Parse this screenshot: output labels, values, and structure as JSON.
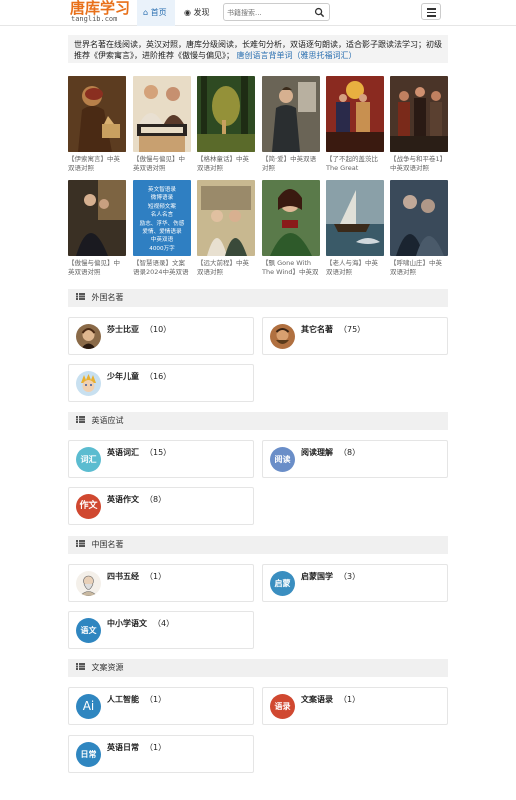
{
  "header": {
    "logo_cn": "唐库学习",
    "logo_en": "tanglib.com",
    "tabs": [
      {
        "label": "首页",
        "active": true
      },
      {
        "label": "发现",
        "active": false
      }
    ],
    "search_placeholder": "书籍搜索..."
  },
  "intro": {
    "text": "世界名著在线阅读，英汉对照，唐库分级阅读，长难句分析，双语逐句朗读，适合影子跟读法学习；初级推荐《伊索寓言》，进阶推荐《傲慢与偏见》；",
    "link": "唐创语言背单词（雅思托福词汇）"
  },
  "books": [
    {
      "caption": "【伊索寓言】中英双语对照"
    },
    {
      "caption": "【傲慢与偏见】中英双语对照"
    },
    {
      "caption": "【格林童话】中英双语对照"
    },
    {
      "caption": "【简·爱】中英双语对照"
    },
    {
      "caption": "【了不起的盖茨比 The Great Gatsby..."
    },
    {
      "caption": "【战争与和平卷1】中英双语对照"
    },
    {
      "caption": "【傲慢与偏见】中英双语对照"
    },
    {
      "caption": "【智慧语录】文案语录2024中英双语版"
    },
    {
      "caption": "【远大前程】中英双语对照"
    },
    {
      "caption": "【飘 Gone With The Wind】中英双语对..."
    },
    {
      "caption": "【老人与海】中英双语对照"
    },
    {
      "caption": "【呼啸山庄】中英双语对照"
    }
  ],
  "promo_cover": [
    "英文智语录",
    "微博语录",
    "短视频文案",
    "名人名言",
    "励志、浮华、伤感",
    "爱情、爱情语录",
    "中英双语",
    "4000万字"
  ],
  "sections": [
    {
      "title": "外国名著",
      "items": [
        {
          "name": "莎士比亚",
          "count": "（10）"
        },
        {
          "name": "其它名著",
          "count": "（75）"
        },
        {
          "name": "少年儿童",
          "count": "（16）"
        }
      ]
    },
    {
      "title": "英语应试",
      "items": [
        {
          "name": "英语词汇",
          "count": "（15）",
          "icon_text": "词汇"
        },
        {
          "name": "阅读理解",
          "count": "（8）",
          "icon_text": "阅读"
        },
        {
          "name": "英语作文",
          "count": "（8）",
          "icon_text": "作文"
        }
      ]
    },
    {
      "title": "中国名著",
      "items": [
        {
          "name": "四书五经",
          "count": "（1）"
        },
        {
          "name": "启蒙国学",
          "count": "（3）",
          "icon_text": "启蒙"
        },
        {
          "name": "中小学语文",
          "count": "（4）",
          "icon_text": "语文"
        }
      ]
    },
    {
      "title": "文案资源",
      "items": [
        {
          "name": "人工智能",
          "count": "（1）",
          "icon_text": "Ai"
        },
        {
          "name": "文案语录",
          "count": "（1）",
          "icon_text": "语录"
        },
        {
          "name": "英语日常",
          "count": "（1）",
          "icon_text": "日常"
        }
      ]
    }
  ],
  "colors": {
    "accent": "#2a6fb0",
    "logo": "#e8701a"
  }
}
